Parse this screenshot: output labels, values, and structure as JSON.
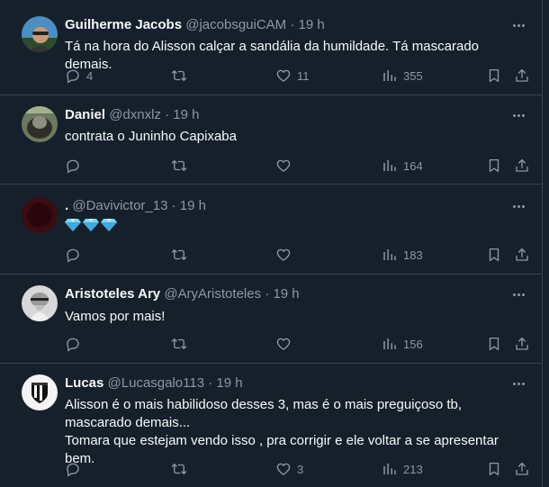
{
  "tweets": [
    {
      "name": "Guilherme Jacobs",
      "handle": "@jacobsguiCAM",
      "dot": "·",
      "time": "19 h",
      "text": "Tá na hora do Alisson calçar a sandália da humildade. Tá mascarado demais.",
      "replies": "4",
      "retweets": "",
      "likes": "11",
      "views": "355",
      "avatar_icon": "avatar-photo"
    },
    {
      "name": "Daniel",
      "handle": "@dxnxlz",
      "dot": "·",
      "time": "19 h",
      "text": "contrata o Juninho Capixaba",
      "replies": "",
      "retweets": "",
      "likes": "",
      "views": "164",
      "avatar_icon": "avatar-photo"
    },
    {
      "name": ".",
      "handle": "@Davivictor_13",
      "dot": "·",
      "time": "19 h",
      "text": "",
      "emoji": [
        "💎",
        "💎",
        "💎"
      ],
      "replies": "",
      "retweets": "",
      "likes": "",
      "views": "183",
      "avatar_icon": "avatar-photo"
    },
    {
      "name": "Aristoteles Ary",
      "handle": "@AryAristoteles",
      "dot": "·",
      "time": "19 h",
      "text": "Vamos por mais!",
      "replies": "",
      "retweets": "",
      "likes": "",
      "views": "156",
      "avatar_icon": "avatar-photo"
    },
    {
      "name": "Lucas",
      "handle": "@Lucasgalo113",
      "dot": "·",
      "time": "19 h",
      "text": "Alisson é o mais habilidoso desses 3, mas é o mais preguiçoso tb, mascarado demais...\nTomara que estejam vendo isso , pra corrigir  e ele voltar a se apresentar bem.",
      "replies": "",
      "retweets": "",
      "likes": "3",
      "views": "213",
      "avatar_icon": "atletico-crest"
    }
  ],
  "colors": {
    "background": "#15202b",
    "border": "#38444d",
    "muted": "#8b98a5",
    "text": "#f7f9f9"
  }
}
